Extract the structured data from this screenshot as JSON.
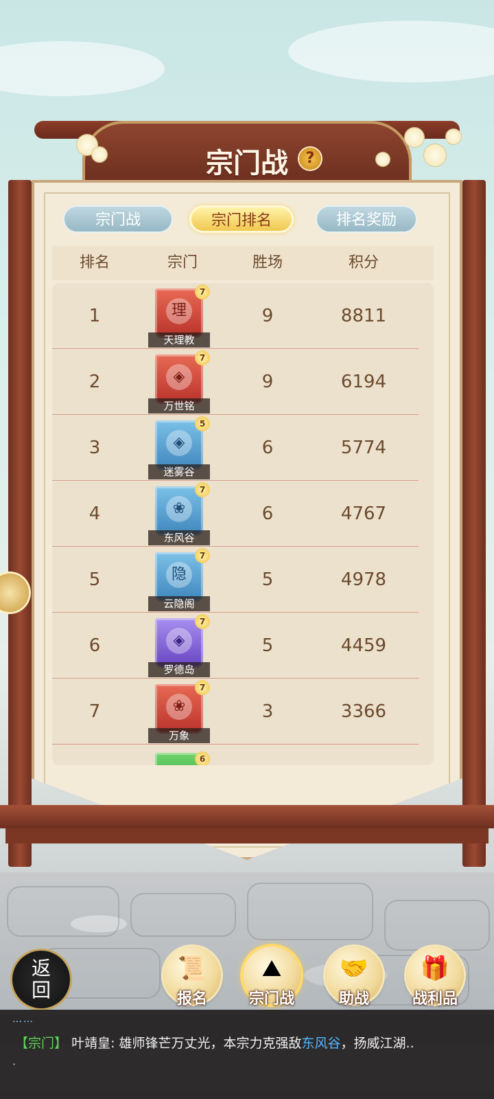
{
  "header": {
    "title": "宗门战",
    "help_icon": "?"
  },
  "tabs": [
    {
      "label": "宗门战",
      "active": false
    },
    {
      "label": "宗门排名",
      "active": true
    },
    {
      "label": "排名奖励",
      "active": false
    }
  ],
  "table": {
    "columns": [
      "排名",
      "宗门",
      "胜场",
      "积分"
    ],
    "rows": [
      {
        "rank": "1",
        "sect": "天理教",
        "emblem": "理",
        "level": "7",
        "wins": "9",
        "points": "8811",
        "color": "red"
      },
      {
        "rank": "2",
        "sect": "万世铭",
        "emblem": "◈",
        "level": "7",
        "wins": "9",
        "points": "6194",
        "color": "red"
      },
      {
        "rank": "3",
        "sect": "迷雾谷",
        "emblem": "◈",
        "level": "5",
        "wins": "6",
        "points": "5774",
        "color": "blue"
      },
      {
        "rank": "4",
        "sect": "东风谷",
        "emblem": "❀",
        "level": "7",
        "wins": "6",
        "points": "4767",
        "color": "blue"
      },
      {
        "rank": "5",
        "sect": "云隐阁",
        "emblem": "隐",
        "level": "7",
        "wins": "5",
        "points": "4978",
        "color": "blue"
      },
      {
        "rank": "6",
        "sect": "罗德岛",
        "emblem": "◈",
        "level": "7",
        "wins": "5",
        "points": "4459",
        "color": "purple"
      },
      {
        "rank": "7",
        "sect": "万象",
        "emblem": "❀",
        "level": "7",
        "wins": "3",
        "points": "3366",
        "color": "red"
      }
    ],
    "partial_next_level": "6"
  },
  "nav": {
    "back": [
      "返",
      "回"
    ],
    "buttons": [
      {
        "label": "报名",
        "icon": "scroll-icon"
      },
      {
        "label": "宗门战",
        "icon": "flag-mountain-icon"
      },
      {
        "label": "助战",
        "icon": "handshake-icon"
      },
      {
        "label": "战利品",
        "icon": "treasure-chest-icon"
      }
    ]
  },
  "chat": {
    "dots": "……",
    "tag": "【宗门】",
    "speaker": "叶靖皇:",
    "text1": "雄师锋芒万丈光，本宗力克强敌",
    "highlight": "东风谷",
    "text2": "，扬威江湖..",
    "trail": "·"
  },
  "colors": {
    "accent": "#f0c850",
    "frame": "#8c3d28",
    "highlight": "#55b8ff",
    "chat_tag": "#5fd35a"
  }
}
